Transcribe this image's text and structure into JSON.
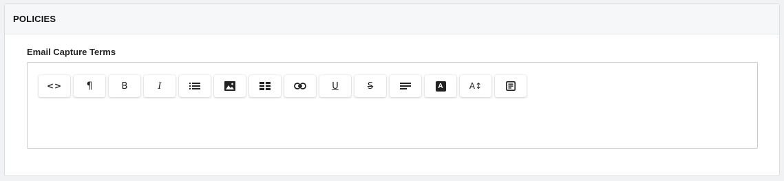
{
  "panel": {
    "title": "POLICIES"
  },
  "field": {
    "label": "Email Capture Terms"
  },
  "toolbar": {
    "buttons": [
      {
        "name": "code-view",
        "icon": "code-icon",
        "glyph": "<>"
      },
      {
        "name": "paragraph",
        "icon": "paragraph-icon",
        "glyph": "¶"
      },
      {
        "name": "bold",
        "icon": "bold-icon",
        "glyph": "B"
      },
      {
        "name": "italic",
        "icon": "italic-icon",
        "glyph": "I"
      },
      {
        "name": "list",
        "icon": "list-icon"
      },
      {
        "name": "image",
        "icon": "image-icon"
      },
      {
        "name": "table",
        "icon": "table-icon"
      },
      {
        "name": "link",
        "icon": "link-icon"
      },
      {
        "name": "underline",
        "icon": "underline-icon",
        "glyph": "U"
      },
      {
        "name": "strikethrough",
        "icon": "strikethrough-icon",
        "glyph": "S"
      },
      {
        "name": "align",
        "icon": "align-left-icon"
      },
      {
        "name": "text-color",
        "icon": "text-color-icon",
        "glyph": "A"
      },
      {
        "name": "font-size",
        "icon": "font-size-icon",
        "glyph": "A↕"
      },
      {
        "name": "template",
        "icon": "template-icon"
      }
    ]
  },
  "editor": {
    "content": ""
  }
}
